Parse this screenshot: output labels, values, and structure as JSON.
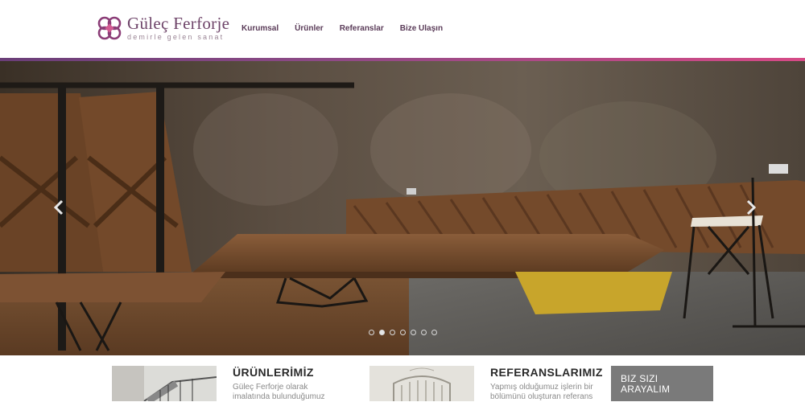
{
  "brand": {
    "name": "Güleç Ferforje",
    "tagline": "demirle gelen sanat",
    "colors": {
      "primary": "#6e4469",
      "accent": "#d64a86"
    }
  },
  "nav": {
    "items": [
      {
        "label": "Kurumsal"
      },
      {
        "label": "Ürünler"
      },
      {
        "label": "Referanslar"
      },
      {
        "label": "Bize Ulaşın"
      }
    ]
  },
  "slider": {
    "prev_icon": "chevron-left-icon",
    "next_icon": "chevron-right-icon",
    "slide_count": 7,
    "active_slide": 2
  },
  "features": {
    "products": {
      "title": "ÜRÜNLERİMİZ",
      "line1": "Güleç Ferforje olarak",
      "line2": "imalatında bulunduğumuz"
    },
    "references": {
      "title": "REFERANSLARIMIZ",
      "line1": "Yapmış olduğumuz işlerin bir",
      "line2": "bölümünü oluşturan referans"
    },
    "contact": {
      "line1": "BIZ SIZI",
      "line2": "ARAYALIM"
    }
  }
}
